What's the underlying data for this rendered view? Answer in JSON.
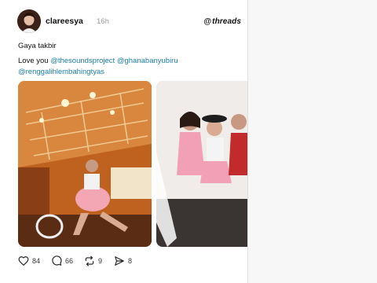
{
  "post": {
    "username": "clareesya",
    "time": "16h",
    "brand": "threads",
    "caption_line1": "Gaya takbir",
    "caption_love": "Love you",
    "mentions": [
      "@thesoundsproject",
      "@ghanabanyubiru",
      "@renggalihlembahingtyas"
    ]
  },
  "actions": {
    "likes": "84",
    "replies": "66",
    "reposts": "9",
    "shares": "8"
  },
  "icons": {
    "like": "heart-icon",
    "reply": "comment-icon",
    "repost": "repost-icon",
    "share": "send-icon"
  }
}
